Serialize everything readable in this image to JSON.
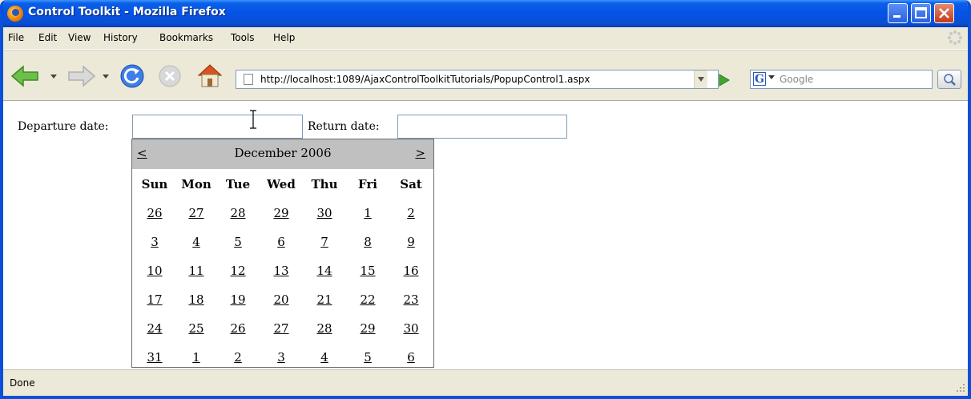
{
  "window": {
    "title": "Control Toolkit - Mozilla Firefox"
  },
  "menubar": {
    "items": [
      "File",
      "Edit",
      "View",
      "History",
      "Bookmarks",
      "Tools",
      "Help"
    ]
  },
  "navbar": {
    "url": "http://localhost:1089/AjaxControlToolkitTutorials/PopupControl1.aspx",
    "search_placeholder": "Google"
  },
  "form": {
    "departure_label": "Departure date:",
    "departure_value": "",
    "return_label": "Return date:",
    "return_value": ""
  },
  "calendar": {
    "prev_label": "<",
    "next_label": ">",
    "month_title": "December 2006",
    "weekdays": [
      "Sun",
      "Mon",
      "Tue",
      "Wed",
      "Thu",
      "Fri",
      "Sat"
    ],
    "weeks": [
      [
        "26",
        "27",
        "28",
        "29",
        "30",
        "1",
        "2"
      ],
      [
        "3",
        "4",
        "5",
        "6",
        "7",
        "8",
        "9"
      ],
      [
        "10",
        "11",
        "12",
        "13",
        "14",
        "15",
        "16"
      ],
      [
        "17",
        "18",
        "19",
        "20",
        "21",
        "22",
        "23"
      ],
      [
        "24",
        "25",
        "26",
        "27",
        "28",
        "29",
        "30"
      ],
      [
        "31",
        "1",
        "2",
        "3",
        "4",
        "5",
        "6"
      ]
    ]
  },
  "status": {
    "text": "Done"
  },
  "colors": {
    "titlebar": "#0553e6",
    "calendar_header": "#c0c0c0",
    "field_border": "#7f9db9"
  }
}
